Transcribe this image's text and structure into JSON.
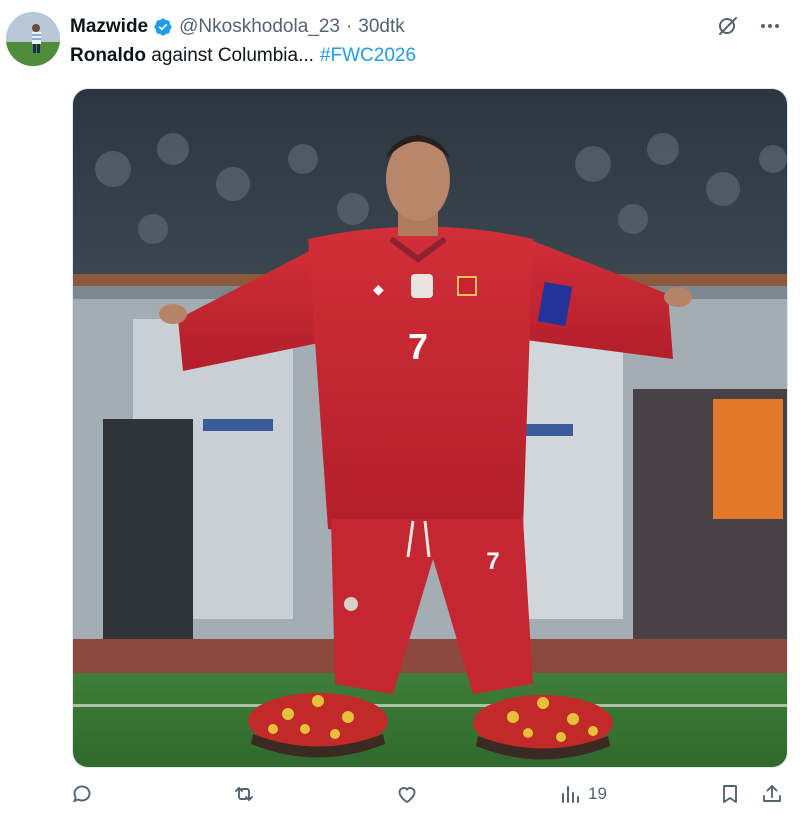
{
  "author": {
    "display_name": "Mazwide",
    "handle": "@Nkoskhodola_23",
    "time": "30dtk"
  },
  "tweet": {
    "bold_text": "Ronaldo",
    "text": " against Columbia...",
    "hashtag": "#FWC2026"
  },
  "media": {
    "description_jersey_front": "7",
    "description_shorts": "7"
  },
  "actions": {
    "reply_count": "",
    "retweet_count": "",
    "like_count": "",
    "views_count": "19"
  },
  "icons": {
    "verified": "verified-badge-icon",
    "grok": "grok-icon",
    "more": "more-icon",
    "reply": "reply-icon",
    "retweet": "retweet-icon",
    "like": "like-icon",
    "views": "views-icon",
    "bookmark": "bookmark-icon",
    "share": "share-icon"
  },
  "colors": {
    "accent": "#1d9bf0",
    "muted": "#536471",
    "jersey": "#c8232f"
  }
}
